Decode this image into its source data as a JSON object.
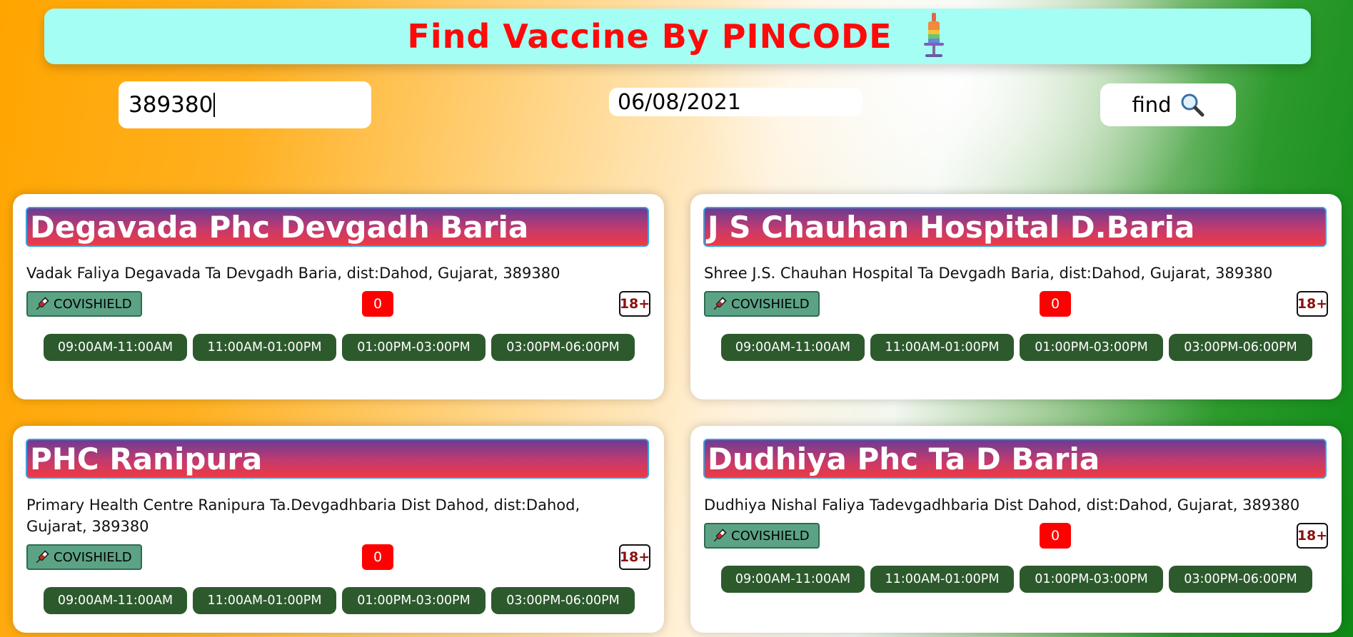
{
  "header": {
    "title": "Find Vaccine By PINCODE"
  },
  "search": {
    "pincode": "389380",
    "date": "06/08/2021",
    "find_label": "find"
  },
  "centers": [
    {
      "name": "Degavada Phc Devgadh Baria",
      "address": "Vadak Faliya Degavada Ta Devgadh Baria, dist:Dahod, Gujarat, 389380",
      "vaccine": "COVISHIELD",
      "capacity": "0",
      "age": "18+",
      "slots": [
        "09:00AM-11:00AM",
        "11:00AM-01:00PM",
        "01:00PM-03:00PM",
        "03:00PM-06:00PM"
      ]
    },
    {
      "name": "J S Chauhan Hospital D.Baria",
      "address": "Shree J.S. Chauhan Hospital Ta Devgadh Baria, dist:Dahod, Gujarat, 389380",
      "vaccine": "COVISHIELD",
      "capacity": "0",
      "age": "18+",
      "slots": [
        "09:00AM-11:00AM",
        "11:00AM-01:00PM",
        "01:00PM-03:00PM",
        "03:00PM-06:00PM"
      ]
    },
    {
      "name": "PHC Ranipura",
      "address": "Primary Health Centre Ranipura Ta.Devgadhbaria Dist Dahod, dist:Dahod, Gujarat, 389380",
      "vaccine": "COVISHIELD",
      "capacity": "0",
      "age": "18+",
      "slots": [
        "09:00AM-11:00AM",
        "11:00AM-01:00PM",
        "01:00PM-03:00PM",
        "03:00PM-06:00PM"
      ]
    },
    {
      "name": "Dudhiya Phc Ta D Baria",
      "address": "Dudhiya Nishal Faliya Tadevgadhbaria Dist Dahod, dist:Dahod, Gujarat, 389380",
      "vaccine": "COVISHIELD",
      "capacity": "0",
      "age": "18+",
      "slots": [
        "09:00AM-11:00AM",
        "11:00AM-01:00PM",
        "01:00PM-03:00PM",
        "03:00PM-06:00PM"
      ]
    }
  ],
  "colors": {
    "title": "#ff0a0a",
    "header_bg": "#a5fef4",
    "capacity_bg": "#ff0000",
    "vaccine_bg": "#5ca386",
    "slot_bg": "#2d5a2d"
  },
  "icons": {
    "header": "syringe-icon",
    "find": "magnifier-icon",
    "vaccine": "syringe-icon"
  }
}
